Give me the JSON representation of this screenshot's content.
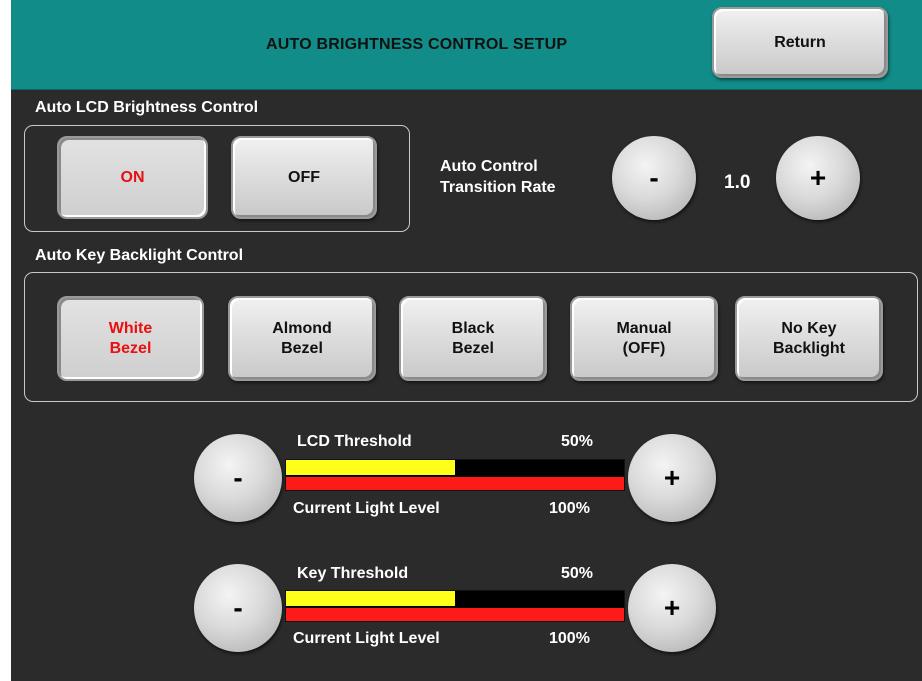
{
  "header": {
    "title": "AUTO BRIGHTNESS CONTROL SETUP",
    "return_label": "Return"
  },
  "lcd_brightness": {
    "label": "Auto LCD Brightness Control",
    "on_label": "ON",
    "off_label": "OFF",
    "selected": "ON"
  },
  "transition_rate": {
    "label_line1": "Auto Control",
    "label_line2": "Transition Rate",
    "value": "1.0",
    "minus": "-",
    "plus": "+"
  },
  "key_backlight": {
    "label": "Auto Key Backlight Control",
    "selected": "White Bezel",
    "options": [
      {
        "line1": "White",
        "line2": "Bezel"
      },
      {
        "line1": "Almond",
        "line2": "Bezel"
      },
      {
        "line1": "Black",
        "line2": "Bezel"
      },
      {
        "line1": "Manual",
        "line2": "(OFF)"
      },
      {
        "line1": "No Key",
        "line2": "Backlight"
      }
    ]
  },
  "lcd_threshold": {
    "label": "LCD Threshold",
    "threshold_text": "50%",
    "threshold_fraction": 0.5,
    "light_label": "Current Light Level",
    "light_text": "100%",
    "light_fraction": 1.0,
    "minus": "-",
    "plus": "+"
  },
  "key_threshold": {
    "label": "Key Threshold",
    "threshold_text": "50%",
    "threshold_fraction": 0.5,
    "light_label": "Current Light Level",
    "light_text": "100%",
    "light_fraction": 1.0,
    "minus": "-",
    "plus": "+"
  },
  "colors": {
    "header_bg": "#118c88",
    "screen_bg": "#2b2b2b",
    "active_text": "#e81010",
    "threshold_fill": "#ffff1a",
    "light_fill": "#ff1a1a"
  }
}
